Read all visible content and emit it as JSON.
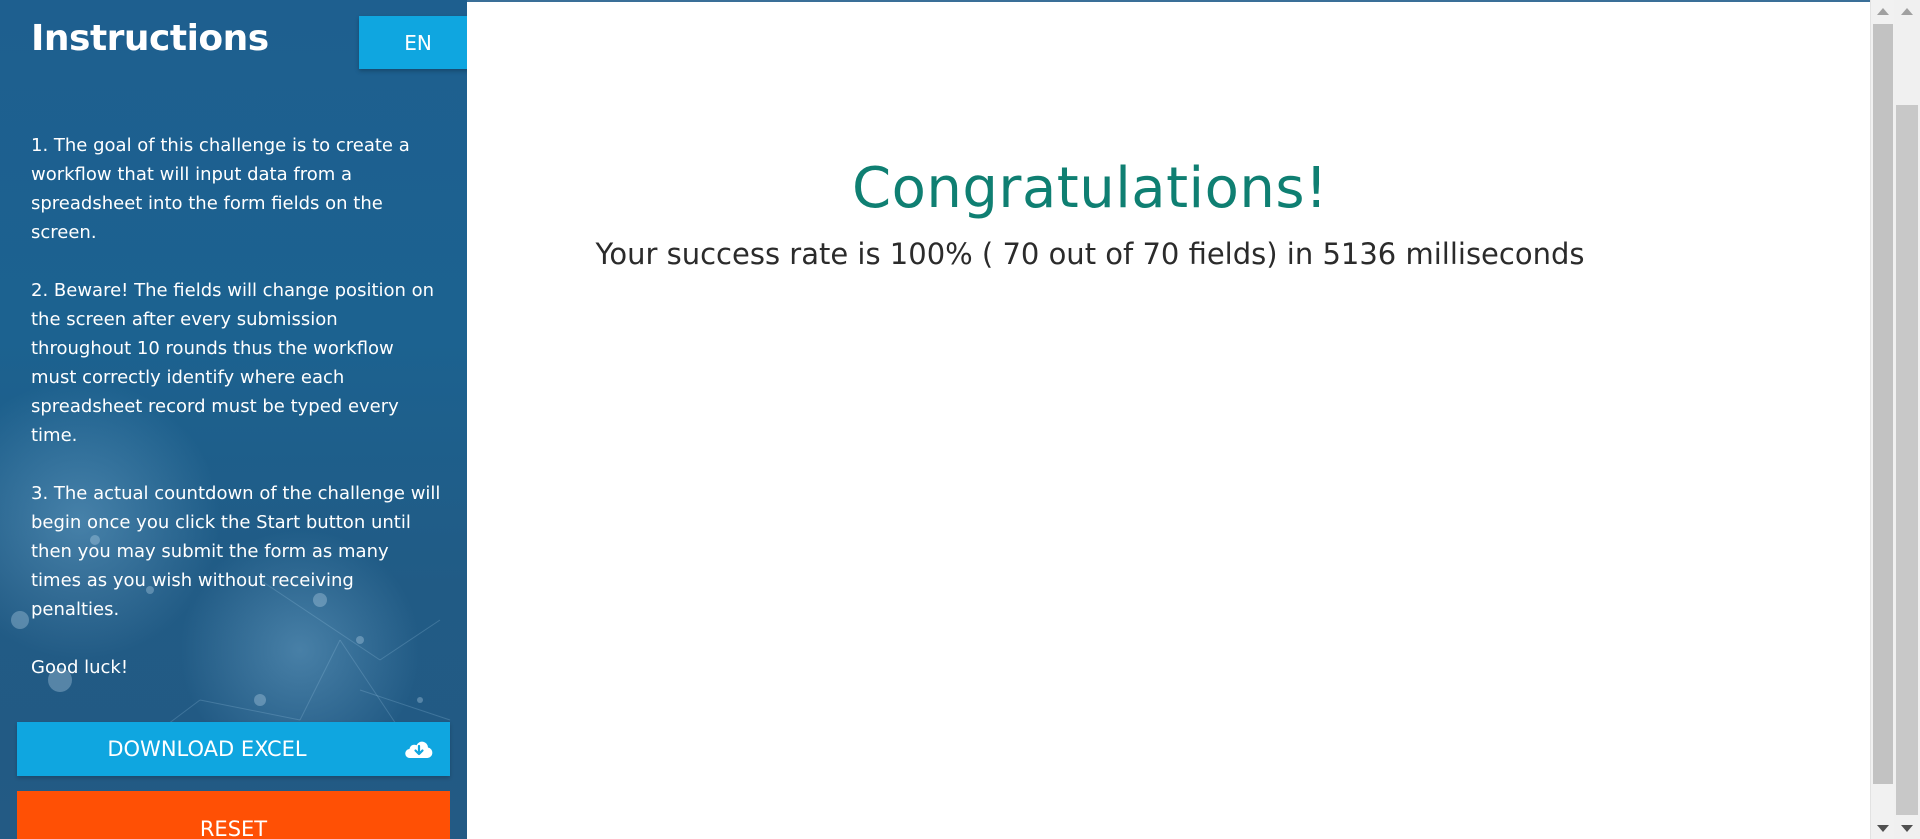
{
  "sidebar": {
    "title": "Instructions",
    "lang_button": "EN",
    "instructions": [
      "1. The goal of this challenge is to create a workflow that will input data from a spreadsheet into the form fields on the screen.",
      "2. Beware! The fields will change position on the screen after every submission throughout 10 rounds thus the workflow must correctly identify where each spreadsheet record must be typed every time.",
      "3. The actual countdown of the challenge will begin once you click the Start button until then you may submit the form as many times as you wish without receiving penalties.",
      "Good luck!"
    ],
    "download_button": "DOWNLOAD EXCEL",
    "download_icon": "cloud-download-icon",
    "reset_button": "RESET"
  },
  "main": {
    "title": "Congratulations!",
    "result": "Your success rate is 100% ( 70 out of 70 fields) in 5136 milliseconds"
  },
  "colors": {
    "sidebar_bg": "#1e5f8f",
    "accent_blue": "#0fa6e0",
    "reset_orange": "#ff5005",
    "title_teal": "#0f7f72"
  }
}
